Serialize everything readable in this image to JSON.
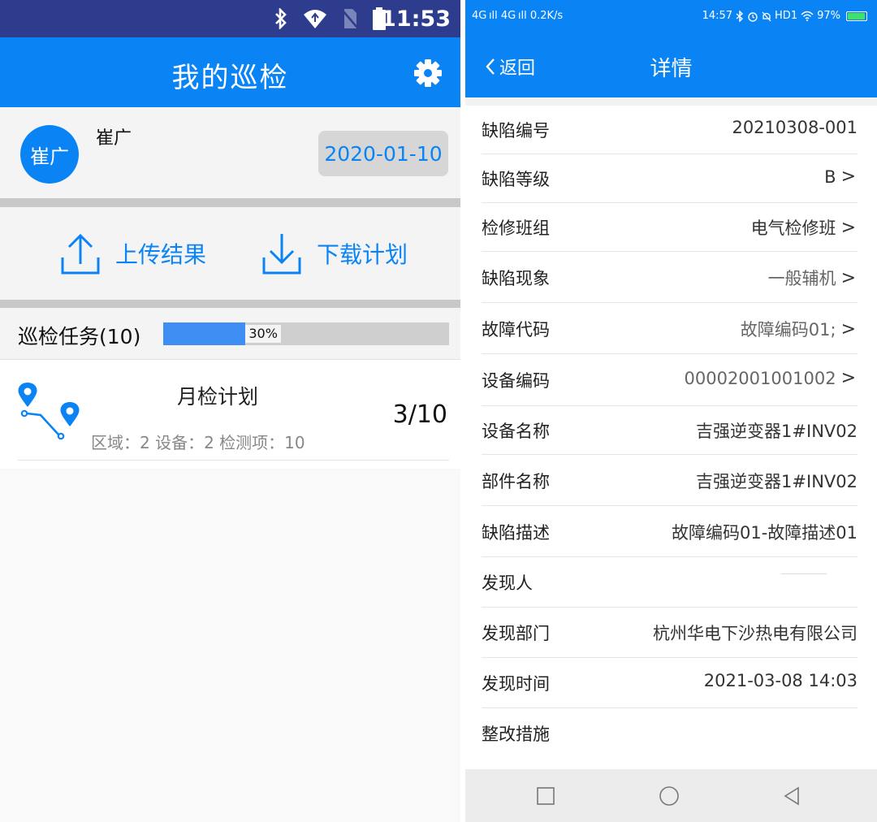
{
  "left": {
    "status_bar": {
      "time": "11:53",
      "icons": [
        "bluetooth-icon",
        "wifi-icon",
        "sim-off-icon",
        "battery-icon"
      ]
    },
    "app_bar": {
      "title": "我的巡检",
      "settings_icon": "gear-icon"
    },
    "user": {
      "avatar_text": "崔广",
      "name": "崔广",
      "date": "2020-01-10"
    },
    "actions": {
      "upload_label": "上传结果",
      "download_label": "下载计划"
    },
    "tasks": {
      "header": "巡检任务(10)",
      "progress_percent": 30,
      "progress_label": "30%"
    },
    "plan": {
      "name": "月检计划",
      "meta": "区域：2 设备：2 检测项：10",
      "count": "3/10"
    }
  },
  "right": {
    "status_bar": {
      "network": "4G ıll  4G ıll 0.2K/s",
      "time": "14:57",
      "right_text": "HD1",
      "battery": "97%"
    },
    "app_bar": {
      "back_label": "返回",
      "title": "详情"
    },
    "fields": [
      {
        "label": "缺陷编号",
        "value": "20210308-001",
        "chevron": false,
        "gray": false
      },
      {
        "label": "缺陷等级",
        "value": "B",
        "chevron": true,
        "gray": false
      },
      {
        "label": "检修班组",
        "value": "电气检修班",
        "chevron": true,
        "gray": false
      },
      {
        "label": "缺陷现象",
        "value": "一般辅机",
        "chevron": true,
        "gray": true
      },
      {
        "label": "故障代码",
        "value": "故障编码01;",
        "chevron": true,
        "gray": true
      },
      {
        "label": "设备编码",
        "value": "00002001001002",
        "chevron": true,
        "gray": true
      },
      {
        "label": "设备名称",
        "value": "吉强逆变器1#INV02",
        "chevron": false,
        "gray": false
      },
      {
        "label": "部件名称",
        "value": "吉强逆变器1#INV02",
        "chevron": false,
        "gray": false
      },
      {
        "label": "缺陷描述",
        "value": "故障编码01-故障描述01",
        "chevron": false,
        "gray": false
      },
      {
        "label": "发现人",
        "value": "",
        "chevron": false,
        "gray": false
      },
      {
        "label": "发现部门",
        "value": "杭州华电下沙热电有限公司",
        "chevron": false,
        "gray": false
      },
      {
        "label": "发现时间",
        "value": "2021-03-08 14:03",
        "chevron": false,
        "gray": false
      },
      {
        "label": "整改措施",
        "value": "",
        "chevron": false,
        "gray": false
      }
    ],
    "nav_bar": [
      "square-nav-icon",
      "circle-home-icon",
      "triangle-back-icon"
    ]
  }
}
